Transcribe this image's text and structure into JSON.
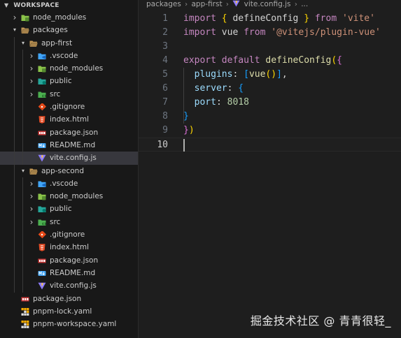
{
  "explorer": {
    "title": "WORKSPACE",
    "items": [
      {
        "label": "node_modules",
        "depth": 1,
        "kind": "node-modules-folder",
        "expanded": false,
        "selected": false
      },
      {
        "label": "packages",
        "depth": 1,
        "kind": "folder",
        "expanded": true,
        "selected": false
      },
      {
        "label": "app-first",
        "depth": 2,
        "kind": "folder",
        "expanded": true,
        "selected": false
      },
      {
        "label": ".vscode",
        "depth": 3,
        "kind": "vscode-folder",
        "expanded": false,
        "selected": false
      },
      {
        "label": "node_modules",
        "depth": 3,
        "kind": "node-modules-folder",
        "expanded": false,
        "selected": false
      },
      {
        "label": "public",
        "depth": 3,
        "kind": "public-folder",
        "expanded": false,
        "selected": false
      },
      {
        "label": "src",
        "depth": 3,
        "kind": "src-folder",
        "expanded": false,
        "selected": false
      },
      {
        "label": ".gitignore",
        "depth": 3,
        "kind": "git-file",
        "selected": false
      },
      {
        "label": "index.html",
        "depth": 3,
        "kind": "html-file",
        "selected": false
      },
      {
        "label": "package.json",
        "depth": 3,
        "kind": "npm-file",
        "selected": false
      },
      {
        "label": "README.md",
        "depth": 3,
        "kind": "markdown-file",
        "selected": false
      },
      {
        "label": "vite.config.js",
        "depth": 3,
        "kind": "vite-file",
        "selected": true
      },
      {
        "label": "app-second",
        "depth": 2,
        "kind": "folder",
        "expanded": true,
        "selected": false
      },
      {
        "label": ".vscode",
        "depth": 3,
        "kind": "vscode-folder",
        "expanded": false,
        "selected": false
      },
      {
        "label": "node_modules",
        "depth": 3,
        "kind": "node-modules-folder",
        "expanded": false,
        "selected": false
      },
      {
        "label": "public",
        "depth": 3,
        "kind": "public-folder",
        "expanded": false,
        "selected": false
      },
      {
        "label": "src",
        "depth": 3,
        "kind": "src-folder",
        "expanded": false,
        "selected": false
      },
      {
        "label": ".gitignore",
        "depth": 3,
        "kind": "git-file",
        "selected": false
      },
      {
        "label": "index.html",
        "depth": 3,
        "kind": "html-file",
        "selected": false
      },
      {
        "label": "package.json",
        "depth": 3,
        "kind": "npm-file",
        "selected": false
      },
      {
        "label": "README.md",
        "depth": 3,
        "kind": "markdown-file",
        "selected": false
      },
      {
        "label": "vite.config.js",
        "depth": 3,
        "kind": "vite-file",
        "selected": false
      },
      {
        "label": "package.json",
        "depth": 1,
        "kind": "npm-file",
        "selected": false
      },
      {
        "label": "pnpm-lock.yaml",
        "depth": 1,
        "kind": "pnpm-file",
        "selected": false
      },
      {
        "label": "pnpm-workspace.yaml",
        "depth": 1,
        "kind": "pnpm-file",
        "selected": false
      }
    ]
  },
  "breadcrumb": {
    "parts": [
      "packages",
      "app-first",
      "vite.config.js",
      "..."
    ]
  },
  "editor": {
    "active_line": 10,
    "lines": [
      {
        "n": "1",
        "tokens": [
          [
            "kw",
            "import"
          ],
          [
            "pl",
            " "
          ],
          [
            "b1",
            "{"
          ],
          [
            "pl",
            " defineConfig "
          ],
          [
            "b1",
            "}"
          ],
          [
            "pl",
            " "
          ],
          [
            "kw",
            "from"
          ],
          [
            "pl",
            " "
          ],
          [
            "str",
            "'vite'"
          ]
        ]
      },
      {
        "n": "2",
        "tokens": [
          [
            "kw",
            "import"
          ],
          [
            "pl",
            " vue "
          ],
          [
            "kw",
            "from"
          ],
          [
            "pl",
            " "
          ],
          [
            "str",
            "'@vitejs/plugin-vue'"
          ]
        ]
      },
      {
        "n": "3",
        "tokens": []
      },
      {
        "n": "4",
        "tokens": [
          [
            "kw",
            "export"
          ],
          [
            "pl",
            " "
          ],
          [
            "kw",
            "default"
          ],
          [
            "pl",
            " "
          ],
          [
            "fn",
            "defineConfig"
          ],
          [
            "b1",
            "("
          ],
          [
            "b2",
            "{"
          ]
        ]
      },
      {
        "n": "5",
        "tokens": [
          [
            "pl",
            "  "
          ],
          [
            "prop",
            "plugins"
          ],
          [
            "pl",
            ": "
          ],
          [
            "b3",
            "["
          ],
          [
            "fn",
            "vue"
          ],
          [
            "b1",
            "()"
          ],
          [
            "b3",
            "]"
          ],
          [
            "pl",
            ","
          ]
        ]
      },
      {
        "n": "6",
        "tokens": [
          [
            "pl",
            "  "
          ],
          [
            "prop",
            "server"
          ],
          [
            "pl",
            ": "
          ],
          [
            "b3",
            "{"
          ]
        ]
      },
      {
        "n": "7",
        "tokens": [
          [
            "pl",
            "  "
          ],
          [
            "prop",
            "port"
          ],
          [
            "pl",
            ": "
          ],
          [
            "num",
            "8018"
          ]
        ]
      },
      {
        "n": "8",
        "tokens": [
          [
            "b3",
            "}"
          ]
        ]
      },
      {
        "n": "9",
        "tokens": [
          [
            "b2",
            "}"
          ],
          [
            "b1",
            ")"
          ]
        ]
      },
      {
        "n": "10",
        "tokens": []
      }
    ]
  },
  "watermark": "掘金技术社区 @ 青青很轻_",
  "colors": {
    "background": "#1e1e1e",
    "sidebar": "#181818",
    "selection": "#37373d",
    "keyword": "#c586c0",
    "string": "#ce9178",
    "function": "#dcdcaa",
    "number": "#b5cea8",
    "property": "#9cdcfe"
  }
}
